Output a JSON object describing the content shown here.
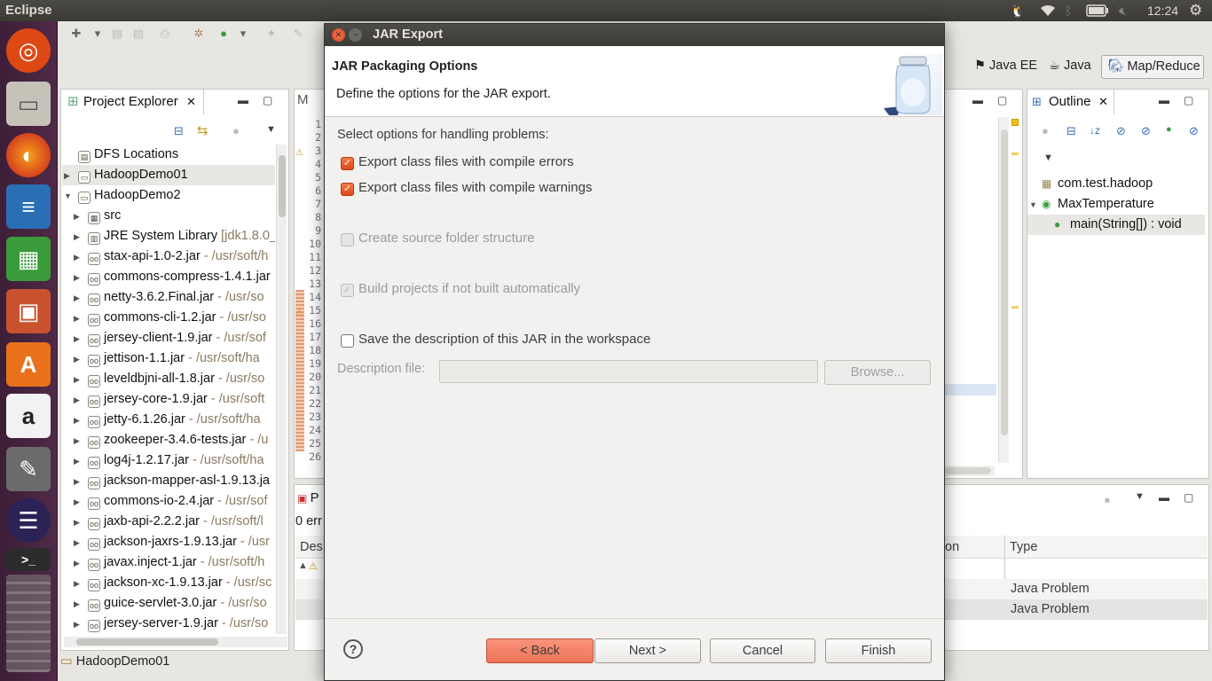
{
  "top_panel": {
    "title": "Eclipse",
    "time": "12:24"
  },
  "launcher": [
    {
      "name": "ubuntu-icon"
    },
    {
      "name": "files-icon"
    },
    {
      "name": "firefox-icon"
    },
    {
      "name": "writer-icon"
    },
    {
      "name": "calc-icon"
    },
    {
      "name": "impress-icon"
    },
    {
      "name": "software-center-icon"
    },
    {
      "name": "amazon-icon"
    },
    {
      "name": "settings-icon"
    },
    {
      "name": "eclipse-icon"
    },
    {
      "name": "terminal-icon"
    }
  ],
  "perspectives": {
    "javaee": "Java EE",
    "java": "Java",
    "mapreduce": "Map/Reduce"
  },
  "project_explorer": {
    "title": "Project Explorer",
    "items": [
      {
        "label": "DFS Locations",
        "path": "",
        "arrow": "",
        "indent": 0,
        "icon": "▤"
      },
      {
        "label": "HadoopDemo01",
        "path": "",
        "arrow": "▶",
        "indent": 0,
        "icon": "▭",
        "selected": true
      },
      {
        "label": "HadoopDemo2",
        "path": "",
        "arrow": "▼",
        "indent": 0,
        "icon": "▭"
      },
      {
        "label": "src",
        "path": "",
        "arrow": "▶",
        "indent": 1,
        "icon": "▦"
      },
      {
        "label": "JRE System Library",
        "path": " [jdk1.8.0_",
        "arrow": "▶",
        "indent": 1,
        "icon": "▥"
      },
      {
        "label": "stax-api-1.0-2.jar",
        "path": " - /usr/soft/h",
        "arrow": "▶",
        "indent": 1,
        "icon": "oo"
      },
      {
        "label": "commons-compress-1.4.1.jar",
        "path": "",
        "arrow": "▶",
        "indent": 1,
        "icon": "oo"
      },
      {
        "label": "netty-3.6.2.Final.jar",
        "path": " - /usr/so",
        "arrow": "▶",
        "indent": 1,
        "icon": "oo"
      },
      {
        "label": "commons-cli-1.2.jar",
        "path": " - /usr/so",
        "arrow": "▶",
        "indent": 1,
        "icon": "oo"
      },
      {
        "label": "jersey-client-1.9.jar",
        "path": " - /usr/sof",
        "arrow": "▶",
        "indent": 1,
        "icon": "oo"
      },
      {
        "label": "jettison-1.1.jar",
        "path": " - /usr/soft/ha",
        "arrow": "▶",
        "indent": 1,
        "icon": "oo"
      },
      {
        "label": "leveldbjni-all-1.8.jar",
        "path": " - /usr/so",
        "arrow": "▶",
        "indent": 1,
        "icon": "oo"
      },
      {
        "label": "jersey-core-1.9.jar",
        "path": " - /usr/soft",
        "arrow": "▶",
        "indent": 1,
        "icon": "oo"
      },
      {
        "label": "jetty-6.1.26.jar",
        "path": " - /usr/soft/ha",
        "arrow": "▶",
        "indent": 1,
        "icon": "oo"
      },
      {
        "label": "zookeeper-3.4.6-tests.jar",
        "path": " - /u",
        "arrow": "▶",
        "indent": 1,
        "icon": "oo"
      },
      {
        "label": "log4j-1.2.17.jar",
        "path": " - /usr/soft/ha",
        "arrow": "▶",
        "indent": 1,
        "icon": "oo"
      },
      {
        "label": "jackson-mapper-asl-1.9.13.ja",
        "path": "",
        "arrow": "▶",
        "indent": 1,
        "icon": "oo"
      },
      {
        "label": "commons-io-2.4.jar",
        "path": " - /usr/sof",
        "arrow": "▶",
        "indent": 1,
        "icon": "oo"
      },
      {
        "label": "jaxb-api-2.2.2.jar",
        "path": " - /usr/soft/l",
        "arrow": "▶",
        "indent": 1,
        "icon": "oo"
      },
      {
        "label": "jackson-jaxrs-1.9.13.jar",
        "path": " - /usr",
        "arrow": "▶",
        "indent": 1,
        "icon": "oo"
      },
      {
        "label": "javax.inject-1.jar",
        "path": " - /usr/soft/h",
        "arrow": "▶",
        "indent": 1,
        "icon": "oo"
      },
      {
        "label": "jackson-xc-1.9.13.jar",
        "path": " - /usr/sc",
        "arrow": "▶",
        "indent": 1,
        "icon": "oo"
      },
      {
        "label": "guice-servlet-3.0.jar",
        "path": " - /usr/so",
        "arrow": "▶",
        "indent": 1,
        "icon": "oo"
      },
      {
        "label": "jersey-server-1.9.jar",
        "path": " - /usr/so",
        "arrow": "▶",
        "indent": 1,
        "icon": "oo"
      }
    ]
  },
  "status_bar": {
    "text": "HadoopDemo01"
  },
  "editor": {
    "tab_label": "M",
    "line_numbers": [
      "1",
      "2",
      "3",
      "4",
      "5",
      "6",
      "7",
      "8",
      "9",
      "10",
      "11",
      "12",
      "13",
      "14",
      "15",
      "16",
      "17",
      "18",
      "19",
      "20",
      "21",
      "22",
      "23",
      "24",
      "25",
      "26"
    ]
  },
  "outline": {
    "title": "Outline",
    "items": [
      {
        "label": "com.test.hadoop",
        "indent": 0,
        "arrow": "",
        "icon": "▦"
      },
      {
        "label": "MaxTemperature",
        "indent": 0,
        "arrow": "▼",
        "icon": "◉"
      },
      {
        "label": "main(String[]) : void",
        "indent": 1,
        "arrow": "",
        "icon": "●",
        "selected": true
      }
    ]
  },
  "problems": {
    "tab": "P",
    "summary": "0 err",
    "col_description": "Des",
    "col_location": "on",
    "col_type": "Type",
    "rows": [
      {
        "type": "Java Problem"
      },
      {
        "type": "Java Problem"
      }
    ]
  },
  "dialog": {
    "title": "JAR Export",
    "header_title": "JAR Packaging Options",
    "header_desc": "Define the options for the JAR export.",
    "problems_label": "Select options for handling problems:",
    "opt_errors": "Export class files with compile errors",
    "opt_warnings": "Export class files with compile warnings",
    "opt_source_folders": "Create source folder structure",
    "opt_build": "Build projects if not built automatically",
    "opt_save_desc": "Save the description of this JAR in the workspace",
    "desc_file_label": "Description file:",
    "desc_file_value": "",
    "browse": "Browse...",
    "help": "?",
    "back": "< Back",
    "next": "Next >",
    "cancel": "Cancel",
    "finish": "Finish"
  }
}
